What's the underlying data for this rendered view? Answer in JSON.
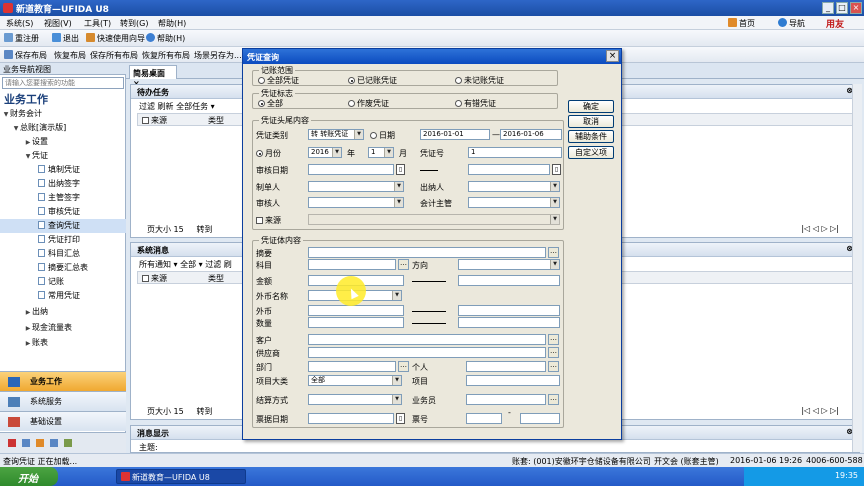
{
  "app": {
    "title": "新道教育—UFIDA U8",
    "nav_home": "首页",
    "nav_nav": "导航",
    "brand": "用友"
  },
  "menu": [
    "系统(S)",
    "视图(V)",
    "工具(T)",
    "转到(G)",
    "帮助(H)"
  ],
  "toolbar1": [
    "重注册",
    "退出",
    "快速使用向导",
    "帮助(H)"
  ],
  "toolbar2": [
    "保存布局",
    "恢复布局",
    "保存所有布局",
    "恢复所有布局",
    "场景另存为..."
  ],
  "leftpanel": {
    "header": "业务导航视图",
    "search_placeholder": "请输入您要搜索的功能",
    "title": "业务工作",
    "tree": [
      "财务会计",
      "总账[演示版]",
      "设置",
      "凭证",
      "填制凭证",
      "出纳签字",
      "主管签字",
      "审核凭证",
      "查询凭证",
      "凭证打印",
      "科目汇总",
      "摘要汇总表",
      "记账",
      "常用凭证",
      "出纳",
      "现金流量表",
      "账表"
    ],
    "nav_buttons": [
      "业务工作",
      "系统服务",
      "基础设置"
    ]
  },
  "center": {
    "tab": "简易桌面",
    "panel1": {
      "title": "待办任务",
      "tools": "过滤  刷新  全部任务 ▾",
      "col_source": "来源",
      "col_type": "类型",
      "page_size_label": "页大小",
      "page_size": "15",
      "goto": "转到"
    },
    "panel2": {
      "title": "系统消息",
      "tools": "所有通知 ▾  全部 ▾  过滤  刷",
      "col_source": "来源",
      "col_type": "类型",
      "page_size_label": "页大小",
      "page_size": "15",
      "goto": "转到"
    },
    "panel3": {
      "title": "消息显示",
      "subject_label": "主题:"
    }
  },
  "dialog": {
    "title": "凭证查询",
    "scope": {
      "label": "记账范围",
      "options": [
        "全部凭证",
        "已记账凭证",
        "未记账凭证"
      ]
    },
    "flag": {
      "label": "凭证标志",
      "options": [
        "全部",
        "作废凭证",
        "有错凭证"
      ]
    },
    "head": {
      "label": "凭证头尾内容",
      "type_label": "凭证类别",
      "type_value": "转 转账凭证",
      "date_label": "日期",
      "date_from": "2016-01-01",
      "date_to": "2016-01-06",
      "month_label": "月份",
      "year": "2016",
      "year_unit": "年",
      "month": "1",
      "month_unit": "月",
      "no_label": "凭证号",
      "no_value": "1",
      "audit_date": "审核日期",
      "maker": "制单人",
      "cashier": "出纳人",
      "auditor": "审核人",
      "supervisor": "会计主管",
      "source": "来源"
    },
    "body": {
      "label": "凭证体内容",
      "summary": "摘要",
      "account": "科目",
      "direction": "方向",
      "amount": "金额",
      "currency": "外币名称",
      "foreign": "外币",
      "quantity": "数量",
      "customer": "客户",
      "supplier": "供应商",
      "dept": "部门",
      "person": "个人",
      "project_class": "项目大类",
      "project_class_value": "全部",
      "project": "项目",
      "settle": "结算方式",
      "salesman": "业务员",
      "bill_date": "票据日期",
      "bill_no": "票号"
    },
    "buttons": [
      "确定",
      "取消",
      "辅助条件",
      "自定义项"
    ]
  },
  "statusbar": {
    "left": "查询凭证 正在加载...",
    "account": "账套: (001)安徽环宇仓储设备有限公司",
    "user": "开文会 (账套主管)",
    "date": "2016-01-06 19:26",
    "phone": "4006-600-588"
  },
  "taskbar": {
    "start": "开始",
    "task": "新道教育—UFIDA U8",
    "clock": "19:35"
  }
}
